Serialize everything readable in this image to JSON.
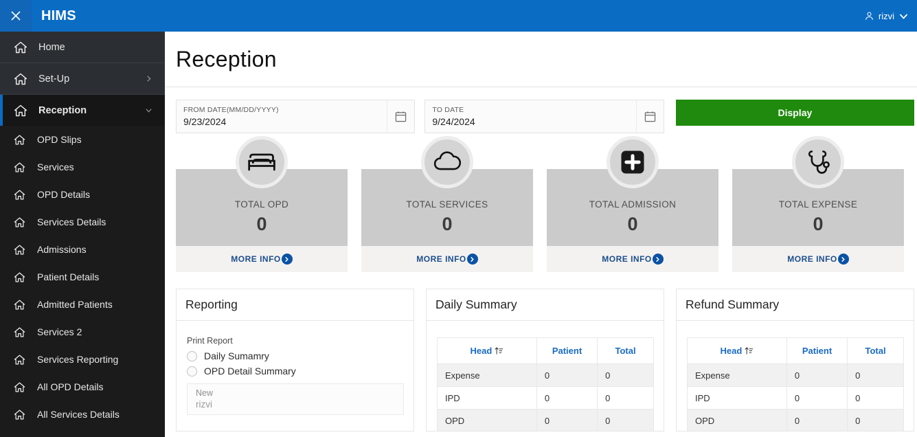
{
  "topbar": {
    "close_icon": "close-icon",
    "app_title": "HIMS",
    "user_icon": "person-icon",
    "user_name": "rizvi",
    "chevron_icon": "chevron-down-icon"
  },
  "sidebar": {
    "top_items": [
      {
        "label": "Home",
        "icon": "home-icon",
        "chevron": "",
        "selected": false
      },
      {
        "label": "Set-Up",
        "icon": "home-icon",
        "chevron": "chevron-right-icon",
        "selected": false
      },
      {
        "label": "Reception",
        "icon": "home-icon",
        "chevron": "chevron-down-icon",
        "selected": true
      }
    ],
    "sub_items": [
      {
        "label": "OPD Slips",
        "icon": "home-icon"
      },
      {
        "label": "Services",
        "icon": "home-icon"
      },
      {
        "label": "OPD Details",
        "icon": "home-icon"
      },
      {
        "label": "Services Details",
        "icon": "home-icon"
      },
      {
        "label": "Admissions",
        "icon": "home-icon"
      },
      {
        "label": "Patient Details",
        "icon": "home-icon"
      },
      {
        "label": "Admitted Patients",
        "icon": "home-icon"
      },
      {
        "label": "Services 2",
        "icon": "home-icon"
      },
      {
        "label": "Services Reporting",
        "icon": "home-icon"
      },
      {
        "label": "All OPD Details",
        "icon": "home-icon"
      },
      {
        "label": "All Services Details",
        "icon": "home-icon"
      }
    ]
  },
  "page": {
    "title": "Reception"
  },
  "filters": {
    "from_date": {
      "label": "FROM DATE(MM/DD/YYYY)",
      "value": "9/23/2024",
      "calendar_icon": "calendar-icon"
    },
    "to_date": {
      "label": "TO DATE",
      "value": "9/24/2024",
      "calendar_icon": "calendar-icon"
    },
    "display_button": "Display"
  },
  "stat_cards": [
    {
      "label": "TOTAL OPD",
      "value": "0",
      "icon": "bed-icon",
      "more_info": "MORE INFO"
    },
    {
      "label": "TOTAL SERVICES",
      "value": "0",
      "icon": "cloud-icon",
      "more_info": "MORE INFO"
    },
    {
      "label": "TOTAL ADMISSION",
      "value": "0",
      "icon": "medical-plus-icon",
      "more_info": "MORE INFO"
    },
    {
      "label": "TOTAL EXPENSE",
      "value": "0",
      "icon": "stethoscope-icon",
      "more_info": "MORE INFO"
    }
  ],
  "reporting": {
    "title": "Reporting",
    "print_report_label": "Print Report",
    "options": [
      {
        "label": "Daily Sumamry",
        "checked": false
      },
      {
        "label": "OPD Detail Summary",
        "checked": false
      }
    ],
    "select": {
      "placeholder": "New",
      "value": "rizvi"
    }
  },
  "daily_summary": {
    "title": "Daily Summary",
    "columns": [
      "Head",
      "Patient",
      "Total"
    ],
    "sort_icon": "sort-ascending-icon",
    "rows": [
      {
        "head": "Expense",
        "patient": "0",
        "total": "0"
      },
      {
        "head": "IPD",
        "patient": "0",
        "total": "0"
      },
      {
        "head": "OPD",
        "patient": "0",
        "total": "0"
      }
    ]
  },
  "refund_summary": {
    "title": "Refund Summary",
    "columns": [
      "Head",
      "Patient",
      "Total"
    ],
    "sort_icon": "sort-ascending-icon",
    "rows": [
      {
        "head": "Expense",
        "patient": "0",
        "total": "0"
      },
      {
        "head": "IPD",
        "patient": "0",
        "total": "0"
      },
      {
        "head": "OPD",
        "patient": "0",
        "total": "0"
      }
    ]
  },
  "colors": {
    "header_blue": "#0b6cc4",
    "sidebar_dark": "#1b1b1b",
    "accent_green": "#1f8a0d",
    "link_blue": "#1a6bc4",
    "card_gray": "#cbcbcb"
  }
}
